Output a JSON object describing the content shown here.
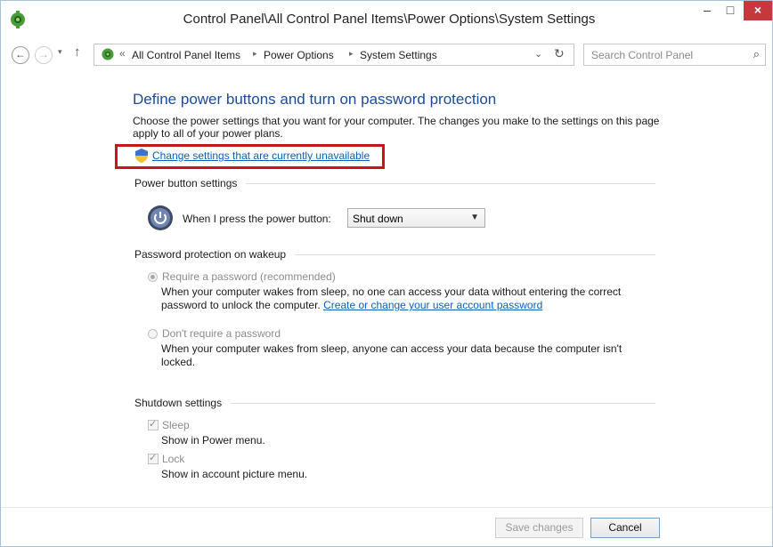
{
  "window": {
    "title": "Control Panel\\All Control Panel Items\\Power Options\\System Settings",
    "minimize": "–",
    "maximize": "□",
    "close": "×"
  },
  "nav": {
    "back_icon": "←",
    "forward_icon": "→",
    "dropdown_icon": "▾",
    "up_icon": "↑",
    "crumb_prefix": "«",
    "breadcrumbs": [
      "All Control Panel Items",
      "Power Options",
      "System Settings"
    ],
    "crumb_sep": "▸",
    "address_dropdown_icon": "⌄",
    "refresh_icon": "↻",
    "search_placeholder": "Search Control Panel",
    "search_icon": "⌕"
  },
  "content": {
    "heading": "Define power buttons and turn on password protection",
    "intro": "Choose the power settings that you want for your computer. The changes you make to the settings on this page apply to all of your power plans.",
    "change_link": "Change settings that are currently unavailable",
    "power_button_section": "Power button settings",
    "power_button_label": "When I press the power button:",
    "power_button_value": "Shut down",
    "password_section": "Password protection on wakeup",
    "require_password_label": "Require a password (recommended)",
    "require_password_desc": "When your computer wakes from sleep, no one can access your data without entering the correct password to unlock the computer.",
    "require_password_link": "Create or change your user account password",
    "no_password_label": "Don't require a password",
    "no_password_desc": "When your computer wakes from sleep, anyone can access your data because the computer isn't locked.",
    "shutdown_section": "Shutdown settings",
    "sleep_label": "Sleep",
    "sleep_desc": "Show in Power menu.",
    "lock_label": "Lock",
    "lock_desc": "Show in account picture menu."
  },
  "footer": {
    "save_label": "Save changes",
    "cancel_label": "Cancel"
  },
  "colors": {
    "link": "#0b5fc0",
    "heading": "#1b4b9a",
    "highlight_border": "#c4161c",
    "close_button": "#c7383d"
  }
}
